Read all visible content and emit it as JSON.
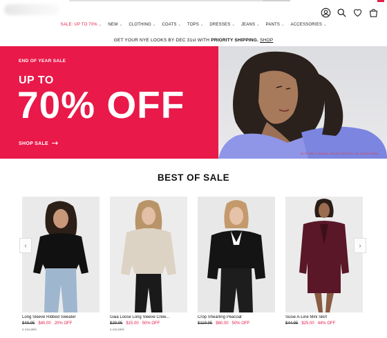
{
  "header": {
    "icons": [
      "account-icon",
      "search-icon",
      "heart-icon",
      "bag-icon"
    ]
  },
  "nav": [
    {
      "label": "SALE: UP TO 70%"
    },
    {
      "label": "NEW"
    },
    {
      "label": "CLOTHING"
    },
    {
      "label": "COATS"
    },
    {
      "label": "TOPS"
    },
    {
      "label": "DRESSES"
    },
    {
      "label": "JEANS"
    },
    {
      "label": "PANTS"
    },
    {
      "label": "ACCESSORIES"
    }
  ],
  "promo": {
    "text": "GET YOUR NYE LOOKS BY DEC 31st WITH ",
    "bold": "PRIORITY SHIPPING.",
    "link": "SHOP"
  },
  "hero": {
    "eyebrow": "END OF YEAR SALE",
    "upto": "UP TO",
    "headline": "70% OFF",
    "cta": "SHOP SALE",
    "note": "IN STORE & ONLINE. SELECT STYLES. ALL SALES FINAL"
  },
  "section": {
    "title": "BEST OF SALE"
  },
  "products": [
    {
      "name": "Long Sleeve Ribbed Sweater",
      "was": "$49.95",
      "now": "$40.00",
      "pct": "20% OFF",
      "colors": "3 COLORS"
    },
    {
      "name": "Gaia Loose Long Sleeve Crew...",
      "was": "$29.95",
      "now": "$15.00",
      "pct": "50% OFF",
      "colors": "3 COLORS"
    },
    {
      "name": "Crop Shearling Peacoat",
      "was": "$119.95",
      "now": "$60.00",
      "pct": "50% OFF",
      "colors": ""
    },
    {
      "name": "Susie A-Line Mini Skirt",
      "was": "$44.95",
      "now": "$25.00",
      "pct": "44% OFF",
      "colors": ""
    }
  ],
  "colors": {
    "accent": "#e9194a"
  }
}
